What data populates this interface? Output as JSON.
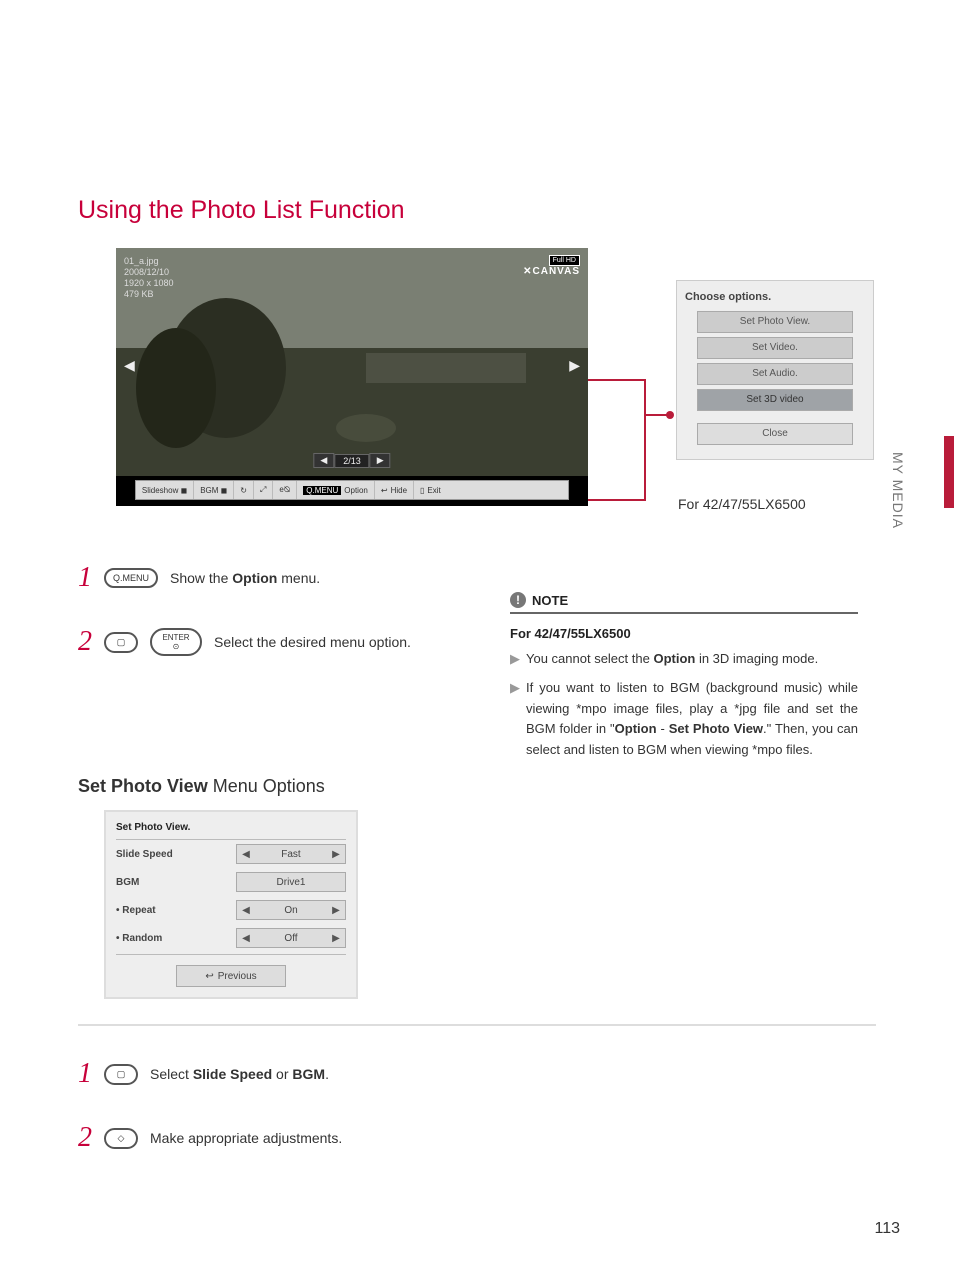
{
  "section_tab": "MY MEDIA",
  "h1": "Using the Photo List Function",
  "screenshot": {
    "file_info": [
      "01_a.jpg",
      "2008/12/10",
      "1920 x 1080",
      "479 KB"
    ],
    "logo_top": "Full HD",
    "logo_bottom": "CANVAS",
    "nav_left": "◀",
    "nav_right": "▶",
    "counter_prev": "◀",
    "counter_label": "2/13",
    "counter_next": "▶",
    "toolbar": {
      "slideshow": "Slideshow ◼",
      "bgm": "BGM ◼",
      "rotate": "↻",
      "zoom": "⤢",
      "energy": "e⦰",
      "option_btn": "Q.MENU",
      "option_label": "Option",
      "hide_icon": "↩",
      "hide_label": "Hide",
      "exit_icon": "▯",
      "exit_label": "Exit"
    }
  },
  "options_panel": {
    "title": "Choose options.",
    "items": [
      "Set Photo View.",
      "Set Video.",
      "Set Audio.",
      "Set 3D video"
    ],
    "close": "Close"
  },
  "for_model": "For 42/47/55LX6500",
  "steps_a": {
    "s1_num": "1",
    "s1_badge": "Q.MENU",
    "s1_text_pre": "Show the ",
    "s1_text_bold": "Option",
    "s1_text_post": " menu.",
    "s2_num": "2",
    "s2_badge1": "▢",
    "s2_badge2": "ENTER\n⊙",
    "s2_text": "Select the desired menu option."
  },
  "h2_bold": "Set Photo View",
  "h2_rest": " Menu Options",
  "settings": {
    "title": "Set Photo View.",
    "rows": [
      {
        "label": "Slide Speed",
        "value": "Fast",
        "arrows": true,
        "sub": false
      },
      {
        "label": "BGM",
        "value": "Drive1",
        "arrows": false,
        "sub": false
      },
      {
        "label": "Repeat",
        "value": "On",
        "arrows": true,
        "sub": true
      },
      {
        "label": "Random",
        "value": "Off",
        "arrows": true,
        "sub": true
      }
    ],
    "previous_icon": "↩",
    "previous_label": "Previous"
  },
  "note": {
    "title": "NOTE",
    "subtitle": "For 42/47/55LX6500",
    "items": [
      {
        "pre": "You cannot select the ",
        "bold": "Option",
        "post": " in 3D imaging mode."
      },
      {
        "pre": "If you want to listen to BGM (background music) while viewing *mpo image files, play a *jpg file and set the BGM folder in \"",
        "bold": "Option",
        "mid": " - ",
        "bold2": "Set Photo View",
        "post": ".\" Then, you can select and listen to BGM when viewing *mpo files."
      }
    ]
  },
  "steps_b": {
    "s1_num": "1",
    "s1_badge": "▢",
    "s1_text_pre": "Select ",
    "s1_text_bold1": "Slide Speed",
    "s1_text_mid": " or ",
    "s1_text_bold2": "BGM",
    "s1_text_post": ".",
    "s2_num": "2",
    "s2_badge": "◇",
    "s2_text": "Make appropriate adjustments."
  },
  "page_number": "113"
}
